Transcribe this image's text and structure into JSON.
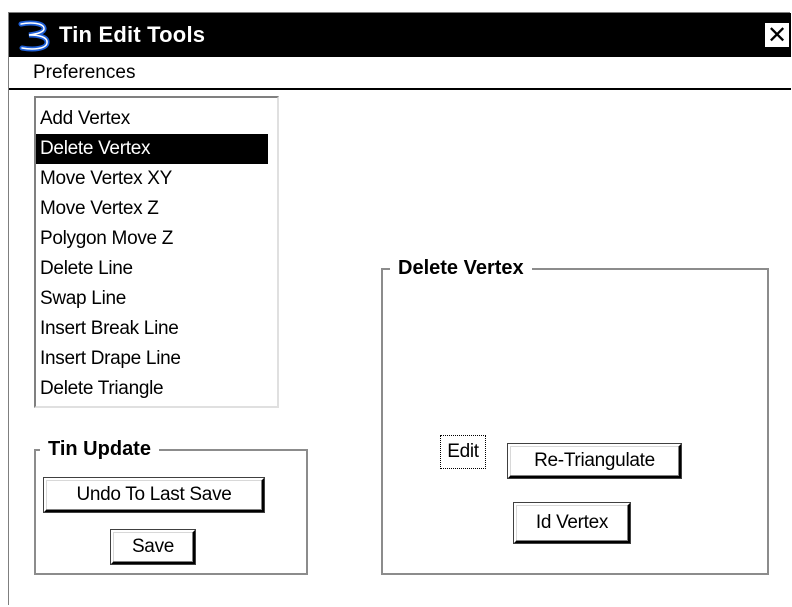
{
  "window": {
    "title": "Tin Edit Tools",
    "app_icon": "bentley-b-icon",
    "close_label": "✕"
  },
  "menubar": {
    "items": [
      {
        "label": "Preferences"
      }
    ]
  },
  "tool_list": {
    "items": [
      {
        "label": "Add Vertex",
        "selected": false
      },
      {
        "label": "Delete Vertex",
        "selected": true
      },
      {
        "label": "Move Vertex XY",
        "selected": false
      },
      {
        "label": "Move Vertex Z",
        "selected": false
      },
      {
        "label": "Polygon Move Z",
        "selected": false
      },
      {
        "label": "Delete Line",
        "selected": false
      },
      {
        "label": "Swap Line",
        "selected": false
      },
      {
        "label": "Insert Break Line",
        "selected": false
      },
      {
        "label": "Insert Drape Line",
        "selected": false
      },
      {
        "label": "Delete Triangle",
        "selected": false
      }
    ]
  },
  "tin_update": {
    "label": "Tin Update",
    "undo_label": "Undo To Last Save",
    "save_label": "Save"
  },
  "delete_vertex_panel": {
    "label": "Delete Vertex",
    "edit_label": "Edit",
    "retriangulate_label": "Re-Triangulate",
    "id_vertex_label": "Id Vertex"
  },
  "colors": {
    "titlebar_bg": "#000000",
    "selection_bg": "#000000",
    "icon_blue": "#1f5fd6"
  }
}
